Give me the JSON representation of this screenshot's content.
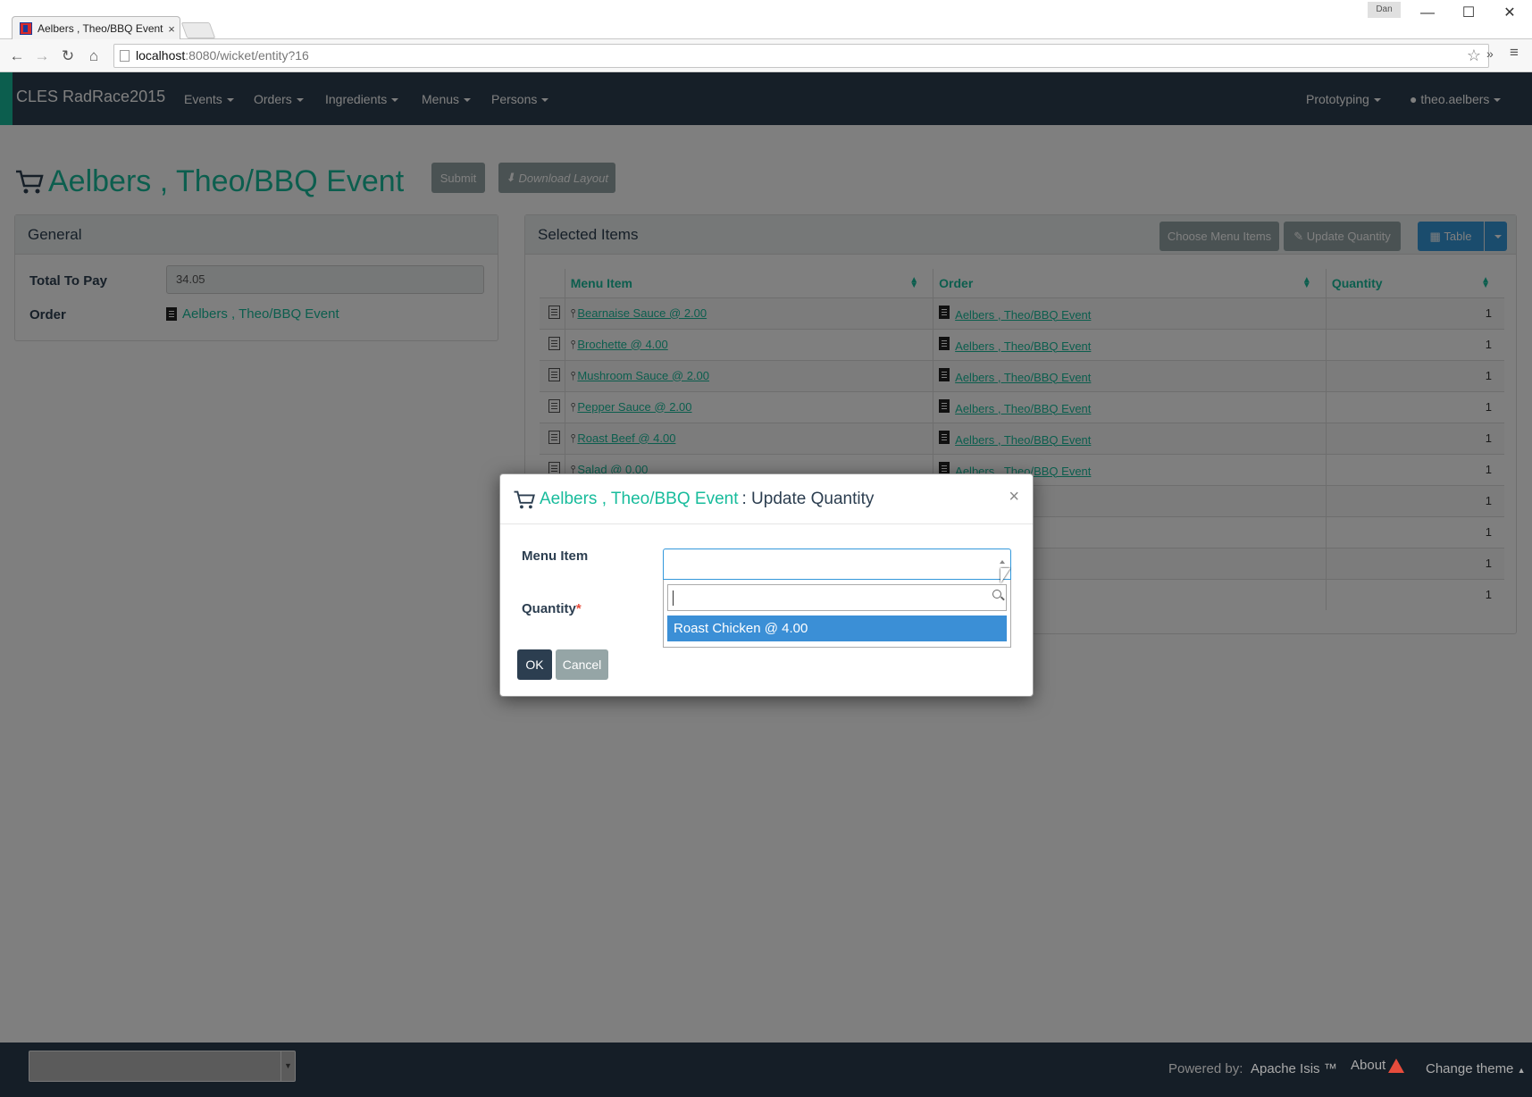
{
  "browser": {
    "tab_title": "Aelbers , Theo/BBQ Event",
    "tab_close": "×",
    "window_user": "Dan",
    "url_host": "localhost",
    "url_rest": ":8080/wicket/entity?16",
    "win_min": "—",
    "win_max": "☐",
    "win_close": "✕"
  },
  "navbar": {
    "brand": "CLES RadRace2015",
    "menus": [
      "Events",
      "Orders",
      "Ingredients",
      "Menus",
      "Persons"
    ],
    "right_menu": "Prototyping",
    "user": "theo.aelbers"
  },
  "page": {
    "title": "Aelbers , Theo/BBQ Event",
    "submit": "Submit",
    "download": "Download Layout"
  },
  "general": {
    "heading": "General",
    "total_label": "Total To Pay",
    "total_value": "34.05",
    "order_label": "Order",
    "order_value": "Aelbers , Theo/BBQ Event"
  },
  "selected_items": {
    "heading": "Selected Items",
    "choose_button": "Choose Menu Items",
    "update_button": "Update Quantity",
    "view_button": "Table",
    "columns": [
      "Menu Item",
      "Order",
      "Quantity"
    ],
    "rows": [
      {
        "item": "Bearnaise Sauce @ 2.00",
        "order": "Aelbers , Theo/BBQ Event",
        "qty": "1"
      },
      {
        "item": "Brochette @ 4.00",
        "order": "Aelbers , Theo/BBQ Event",
        "qty": "1"
      },
      {
        "item": "Mushroom Sauce @ 2.00",
        "order": "Aelbers , Theo/BBQ Event",
        "qty": "1"
      },
      {
        "item": "Pepper Sauce @ 2.00",
        "order": "Aelbers , Theo/BBQ Event",
        "qty": "1"
      },
      {
        "item": "Roast Beef @ 4.00",
        "order": "Aelbers , Theo/BBQ Event",
        "qty": "1"
      },
      {
        "item": "Salad @ 0.00",
        "order": "Aelbers , Theo/BBQ Event",
        "qty": "1"
      },
      {
        "item": "",
        "order": "/BBQ Event",
        "qty": "1"
      },
      {
        "item": "",
        "order": "/BBQ Event",
        "qty": "1"
      },
      {
        "item": "",
        "order": "/BBQ Event",
        "qty": "1"
      },
      {
        "item": "",
        "order": "/BBQ Event",
        "qty": "1"
      }
    ]
  },
  "modal": {
    "entity": "Aelbers , Theo/BBQ Event",
    "action": ": Update Quantity",
    "close": "×",
    "menu_item_label": "Menu Item",
    "quantity_label": "Quantity",
    "required_mark": "*",
    "search_value": "",
    "option": "Roast Chicken @ 4.00",
    "ok": "OK",
    "cancel": "Cancel"
  },
  "footer": {
    "powered_by": "Powered by:",
    "isis": "Apache Isis ™",
    "about": "About",
    "change_theme": "Change theme"
  }
}
